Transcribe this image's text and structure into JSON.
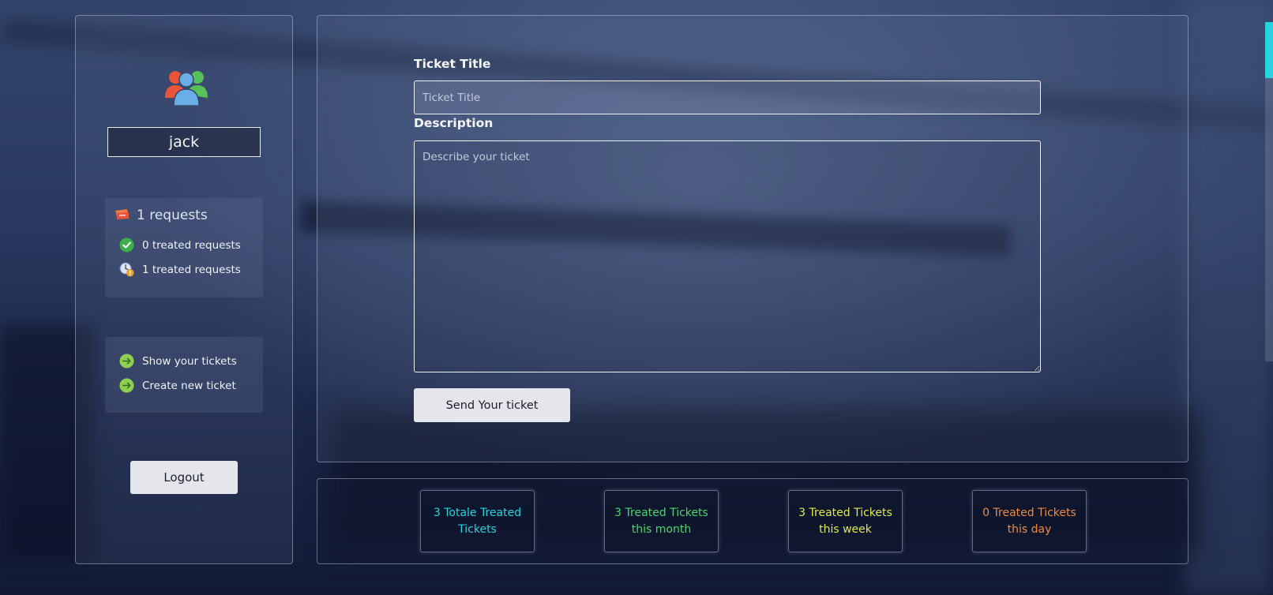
{
  "colors": {
    "accent_cyan": "#27d3dc",
    "month_green": "#48d66c",
    "week_yellow": "#e2e84a",
    "day_orange": "#ec8a43",
    "button_bg": "#e4e6ec"
  },
  "sidebar": {
    "avatar_icon": "users-group-icon",
    "username": "jack",
    "requests": {
      "title": "1 requests",
      "title_icon": "ticket-icon",
      "items": [
        {
          "icon": "check-circle-icon",
          "label": "0 treated requests"
        },
        {
          "icon": "clock-warning-icon",
          "label": "1 treated requests"
        }
      ]
    },
    "nav": [
      {
        "icon": "arrow-right-circle-icon",
        "label": "Show your tickets"
      },
      {
        "icon": "arrow-right-circle-icon",
        "label": "Create new ticket"
      }
    ],
    "logout_label": "Logout"
  },
  "form": {
    "title_label": "Ticket Title",
    "title_placeholder": "Ticket Title",
    "description_label": "Description",
    "description_placeholder": "Describe your ticket",
    "submit_label": "Send Your ticket"
  },
  "stats": [
    {
      "text": "3 Totale Treated Tickets",
      "color": "#27d3dc"
    },
    {
      "text": "3 Treated Tickets this month",
      "color": "#48d66c"
    },
    {
      "text": "3 Treated Tickets this week",
      "color": "#e2e84a"
    },
    {
      "text": "0 Treated Tickets this day",
      "color": "#ec8a43"
    }
  ]
}
